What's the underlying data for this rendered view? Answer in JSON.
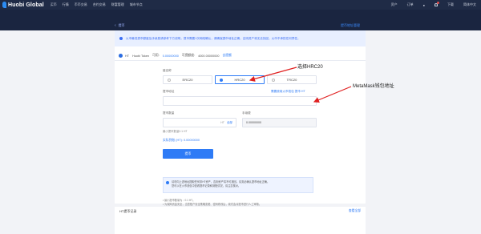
{
  "nav": {
    "logo": "Huobi Global",
    "items": [
      "买币",
      "行情",
      "币币交易",
      "合约交易",
      "财富管理",
      "城市节点"
    ],
    "right_items": [
      "资产",
      "订单",
      "下载",
      "简体中文"
    ]
  },
  "header": {
    "breadcrumb": "提币",
    "back_arrow": "‹",
    "right_link": "提币地址管理"
  },
  "notice": {
    "text": "火币最低提币额度及手续费请参考下方说明，提币需要1次网络确认，请确保提币地址正确，否则资产将无法找回，火币不承担任何责任。"
  },
  "coin": {
    "symbol": "HT",
    "name": "Huobi Token",
    "available_label": "可用:",
    "available_value": "0.00000000",
    "limit_label": "可提额度:",
    "limit_value": "4000.00000000",
    "upgrade_link": "去提额"
  },
  "chain": {
    "label": "链名称",
    "options": [
      "ERC20",
      "HRC20",
      "TRC20"
    ],
    "selected": "HRC20"
  },
  "address": {
    "label": "提币地址",
    "hint": "需要使用火币钱包 提币 HT",
    "placeholder": ""
  },
  "amount": {
    "label": "提币数量",
    "placeholder": "",
    "unit": "HT",
    "all_label": "全部",
    "min_hint": "最小提币数量0.1 HT"
  },
  "fee": {
    "label": "手续费",
    "value": "0.00000000"
  },
  "receive": {
    "label": "实际到账 (HT):",
    "value": "0.00000000"
  },
  "submit_label": "提币",
  "tips": {
    "lines": [
      "请勿向上述地址提取任何非HT资产，否则资产将不可找回。请务必确认提币地址正确。",
      "您可以在火币钱包中查看提币记录和到账情况，请注意核对。"
    ]
  },
  "notes": [
    "• 最小提币数量为：0.1 HT。",
    "• 为保障资金安全，当您账户安全策略变更、密码修改后，我们会对提币进行人工审核。",
    "• 请务必确认电脑及浏览器安全，防止信息被篡改或泄露。"
  ],
  "bottom": {
    "title": "HT提币记录",
    "more": "查看全部"
  },
  "annotations": {
    "a1": "选择HRC20",
    "a2": "MetaMask钱包地址"
  },
  "colors": {
    "nav_bg": "#1f2b46",
    "accent": "#2e7bf6",
    "arrow": "#e02020"
  }
}
